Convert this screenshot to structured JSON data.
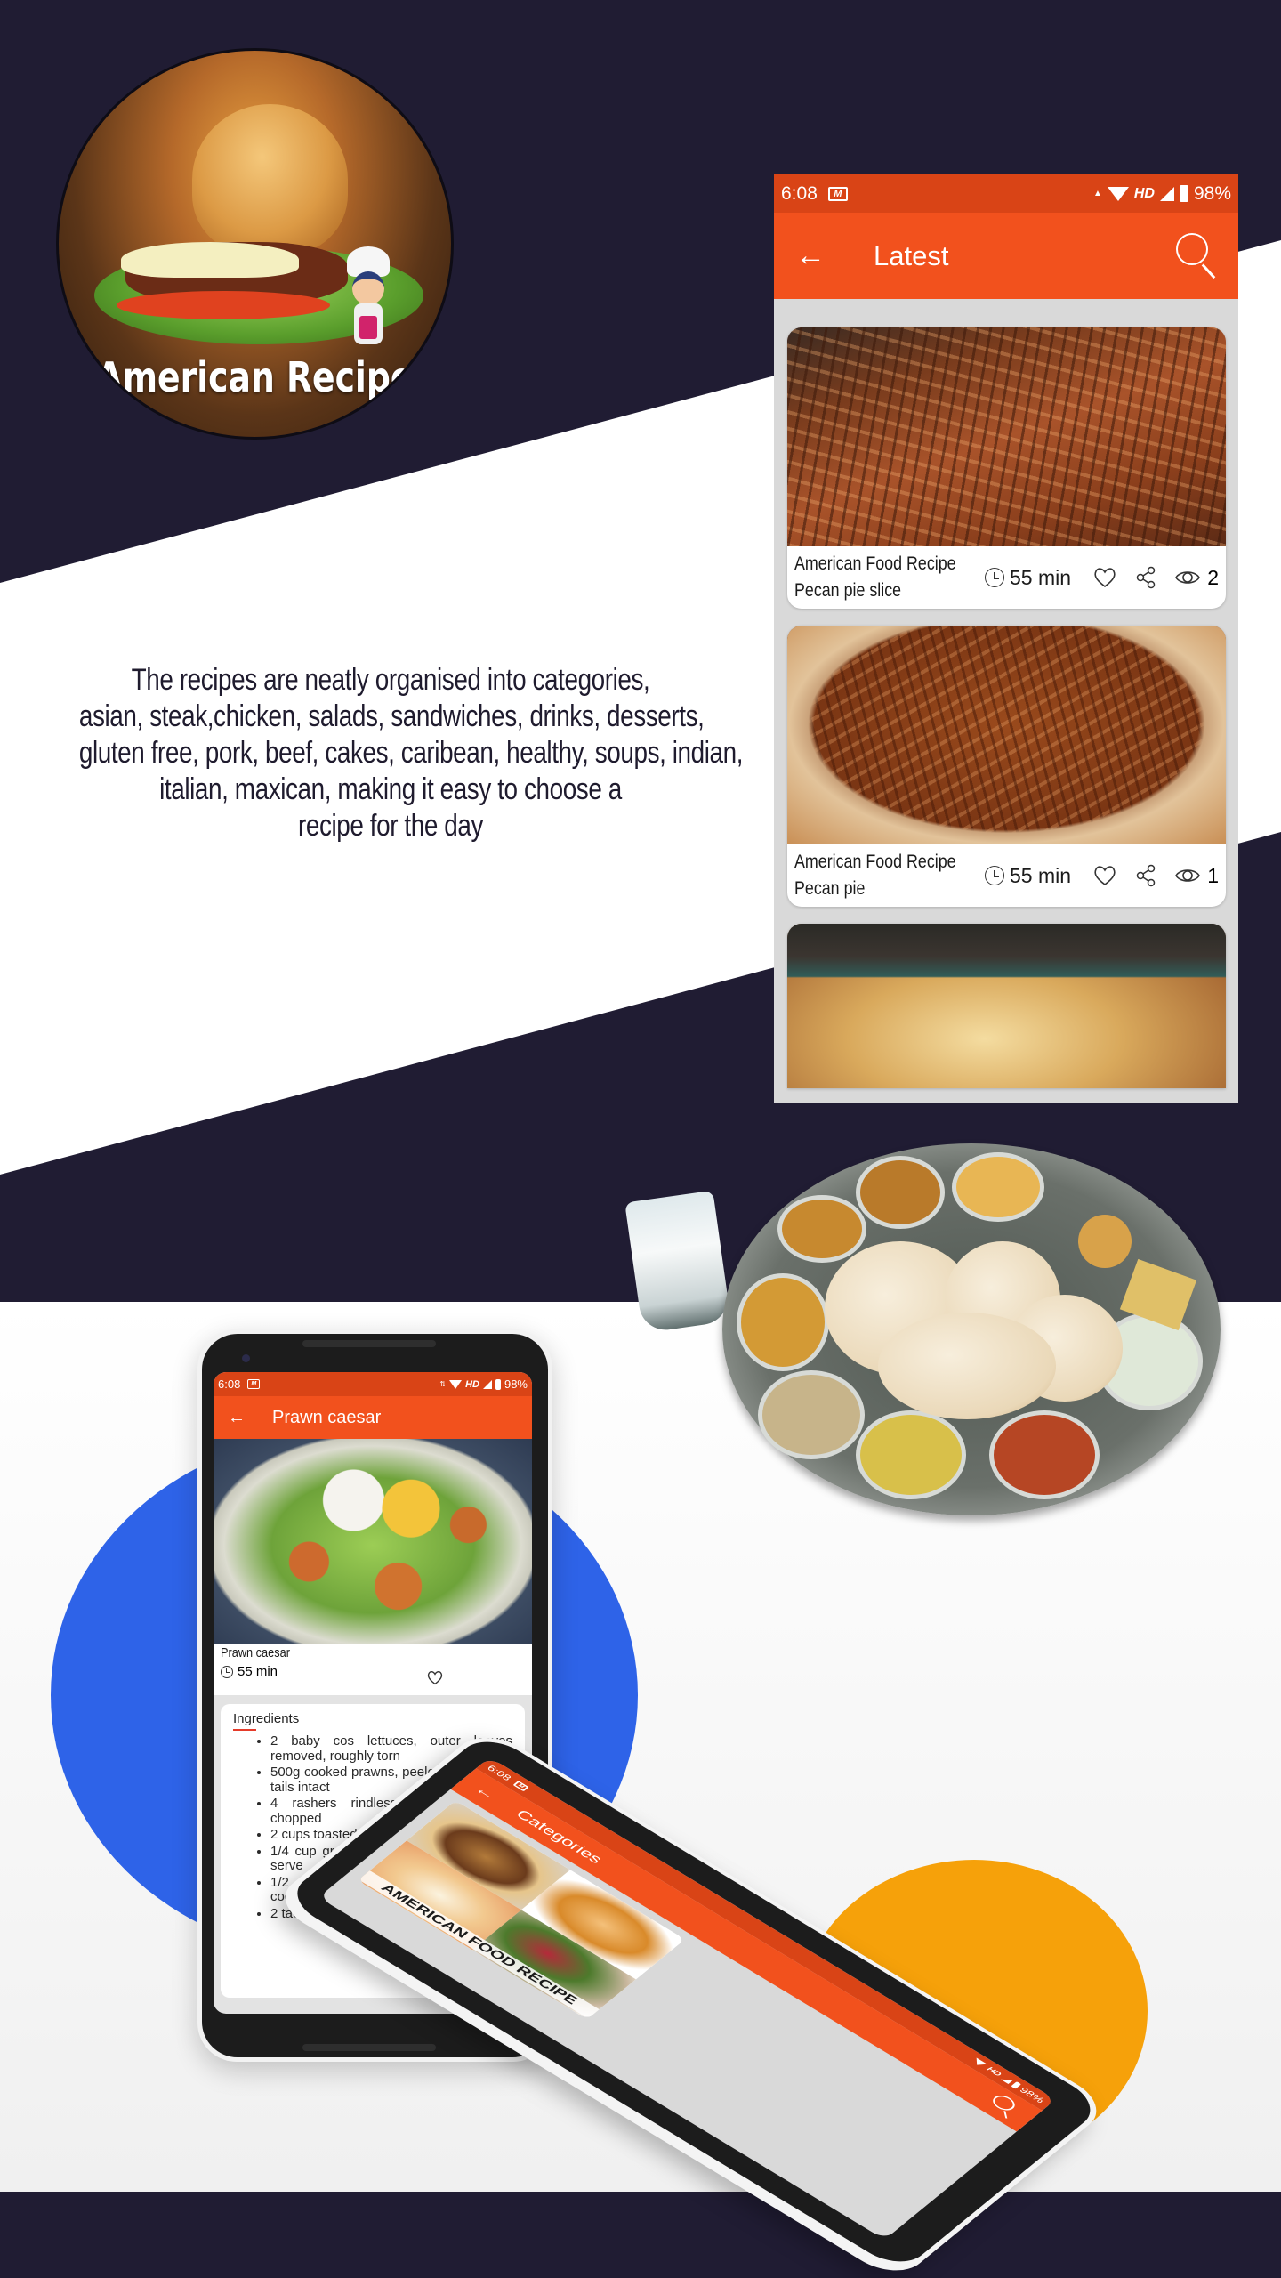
{
  "colors": {
    "navy_background": "#201c33",
    "accent_orange": "#f2511d",
    "statusbar_orange": "#d94416",
    "blue_blob": "#2e63e8",
    "yellow_blob": "#f6a10a",
    "screen_gray": "#d9d9d9"
  },
  "logo": {
    "title": "American Recipe",
    "image": "burger-with-chef-mascot"
  },
  "description": {
    "lines": [
      "The recipes are neatly organised into categories,",
      "asian, steak,chicken, salads, sandwiches, drinks, desserts,",
      "gluten free, pork, beef, cakes, caribean, healthy, soups, indian,",
      "italian, maxican, making it easy to choose a",
      "recipe for the day"
    ]
  },
  "status_bar": {
    "time": "6:08",
    "network": "HD",
    "battery": "98%",
    "icons": [
      "app-notification-icon",
      "data-arrows-icon",
      "wifi-icon",
      "signal-icon",
      "battery-icon"
    ]
  },
  "latest_screen": {
    "title": "Latest",
    "back_icon": "arrow-left-icon",
    "search_icon": "search-icon",
    "recipes": [
      {
        "title_line1": "American Food Recipe",
        "title_line2": "Pecan pie slice",
        "time": "55 min",
        "views": "2",
        "image": "pecan-pie-slices"
      },
      {
        "title_line1": "American Food Recipe",
        "title_line2": "Pecan pie",
        "time": "55 min",
        "views": "1",
        "image": "pecan-pie"
      },
      {
        "title_line1": "",
        "title_line2": "",
        "time": "",
        "views": "",
        "image": "baked-casserole"
      }
    ]
  },
  "detail_screen": {
    "title": "Prawn caesar",
    "recipe_name": "Prawn caesar",
    "time": "55 min",
    "ingredients_heading": "Ingredients",
    "ingredients": [
      "2 baby cos lettuces, outer leaves removed, roughly torn",
      "500g cooked prawns, peeled, de-veined, tails intact",
      "4 rashers rindless bacon, cooked, chopped",
      "2 cups toasted croutons",
      "1/4 cup grated parmesan, plus extra to serve",
      "1/2 cup (125ml) good-quality seafood cocktail sauce",
      "2 tablespoons lemon juice"
    ]
  },
  "categories_screen": {
    "title": "Categories",
    "banner_label": "AMERICAN FOOD RECIPE"
  }
}
